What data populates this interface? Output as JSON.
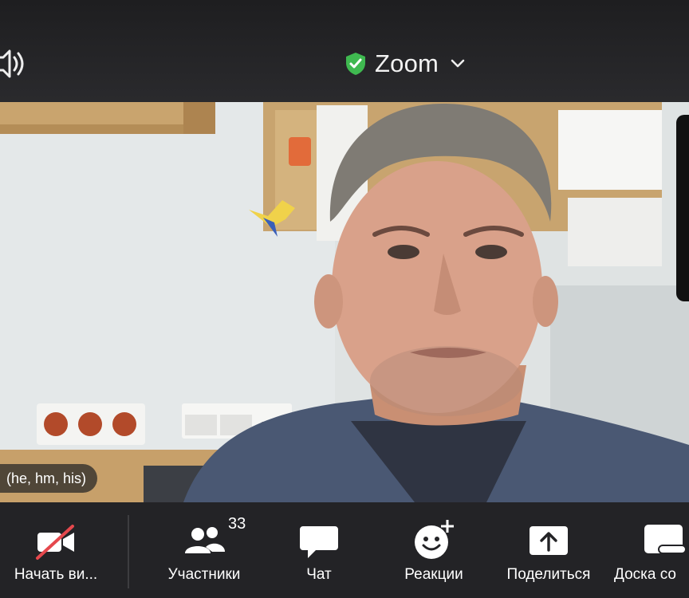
{
  "header": {
    "app_title": "Zoom",
    "icons": [
      "speaker-icon",
      "shield-check-icon",
      "chevron-down-icon"
    ]
  },
  "video": {
    "participant_name_tag": "(he, hm, his)"
  },
  "toolbar": {
    "items": [
      {
        "label": "Начать ви...",
        "icon": "video-off-icon"
      },
      {
        "label": "Участники",
        "icon": "participants-icon",
        "badge": "33"
      },
      {
        "label": "Чат",
        "icon": "chat-icon"
      },
      {
        "label": "Реакции",
        "icon": "reaction-icon"
      },
      {
        "label": "Поделиться",
        "icon": "share-icon"
      },
      {
        "label": "Доска со",
        "icon": "whiteboard-icon"
      }
    ]
  },
  "colors": {
    "shield_green": "#3fb950",
    "toolbar_bg": "#232326",
    "video_off_red": "#e5484d"
  }
}
